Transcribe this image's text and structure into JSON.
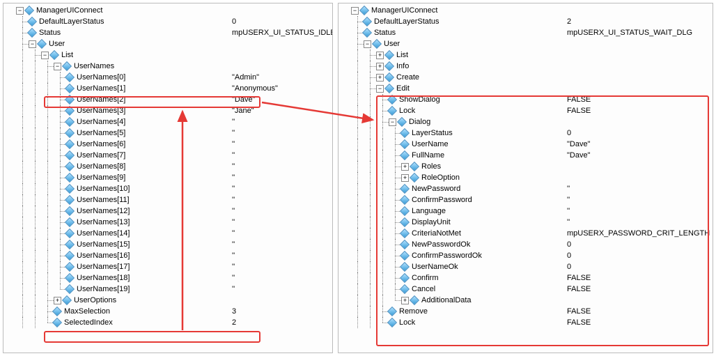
{
  "left": {
    "root": "ManagerUIConnect",
    "DefaultLayerStatus": {
      "label": "DefaultLayerStatus",
      "value": "0"
    },
    "Status": {
      "label": "Status",
      "value": "mpUSERX_UI_STATUS_IDLE"
    },
    "User": {
      "label": "User"
    },
    "List": {
      "label": "List"
    },
    "UserNames": {
      "label": "UserNames",
      "items": [
        {
          "label": "UserNames[0]",
          "value": "\"Admin\""
        },
        {
          "label": "UserNames[1]",
          "value": "\"Anonymous\""
        },
        {
          "label": "UserNames[2]",
          "value": "\"Dave\""
        },
        {
          "label": "UserNames[3]",
          "value": "\"Jane\""
        },
        {
          "label": "UserNames[4]",
          "value": "''"
        },
        {
          "label": "UserNames[5]",
          "value": "''"
        },
        {
          "label": "UserNames[6]",
          "value": "''"
        },
        {
          "label": "UserNames[7]",
          "value": "''"
        },
        {
          "label": "UserNames[8]",
          "value": "''"
        },
        {
          "label": "UserNames[9]",
          "value": "''"
        },
        {
          "label": "UserNames[10]",
          "value": "''"
        },
        {
          "label": "UserNames[11]",
          "value": "''"
        },
        {
          "label": "UserNames[12]",
          "value": "''"
        },
        {
          "label": "UserNames[13]",
          "value": "''"
        },
        {
          "label": "UserNames[14]",
          "value": "''"
        },
        {
          "label": "UserNames[15]",
          "value": "''"
        },
        {
          "label": "UserNames[16]",
          "value": "''"
        },
        {
          "label": "UserNames[17]",
          "value": "''"
        },
        {
          "label": "UserNames[18]",
          "value": "''"
        },
        {
          "label": "UserNames[19]",
          "value": "''"
        }
      ]
    },
    "UserOptions": {
      "label": "UserOptions"
    },
    "MaxSelection": {
      "label": "MaxSelection",
      "value": "3"
    },
    "SelectedIndex": {
      "label": "SelectedIndex",
      "value": "2"
    }
  },
  "right": {
    "root": "ManagerUIConnect",
    "DefaultLayerStatus": {
      "label": "DefaultLayerStatus",
      "value": "2"
    },
    "Status": {
      "label": "Status",
      "value": "mpUSERX_UI_STATUS_WAIT_DLG"
    },
    "User": {
      "label": "User"
    },
    "List": {
      "label": "List"
    },
    "Info": {
      "label": "Info"
    },
    "Create": {
      "label": "Create"
    },
    "Edit": {
      "label": "Edit",
      "ShowDialog": {
        "label": "ShowDialog",
        "value": "FALSE"
      },
      "Lock": {
        "label": "Lock",
        "value": "FALSE"
      },
      "Dialog": {
        "label": "Dialog",
        "LayerStatus": {
          "label": "LayerStatus",
          "value": "0"
        },
        "UserName": {
          "label": "UserName",
          "value": "\"Dave\""
        },
        "FullName": {
          "label": "FullName",
          "value": "\"Dave\""
        },
        "Roles": {
          "label": "Roles"
        },
        "RoleOption": {
          "label": "RoleOption"
        },
        "NewPassword": {
          "label": "NewPassword",
          "value": "''"
        },
        "ConfirmPassword": {
          "label": "ConfirmPassword",
          "value": "''"
        },
        "Language": {
          "label": "Language",
          "value": "''"
        },
        "DisplayUnit": {
          "label": "DisplayUnit",
          "value": "''"
        },
        "CriteriaNotMet": {
          "label": "CriteriaNotMet",
          "value": "mpUSERX_PASSWORD_CRIT_LENGTH"
        },
        "NewPasswordOk": {
          "label": "NewPasswordOk",
          "value": "0"
        },
        "ConfirmPasswordOk": {
          "label": "ConfirmPasswordOk",
          "value": "0"
        },
        "UserNameOk": {
          "label": "UserNameOk",
          "value": "0"
        },
        "Confirm": {
          "label": "Confirm",
          "value": "FALSE"
        },
        "Cancel": {
          "label": "Cancel",
          "value": "FALSE"
        },
        "AdditionalData": {
          "label": "AdditionalData"
        }
      },
      "Remove": {
        "label": "Remove",
        "value": "FALSE"
      },
      "LockOuter": {
        "label": "Lock",
        "value": "FALSE"
      }
    }
  }
}
